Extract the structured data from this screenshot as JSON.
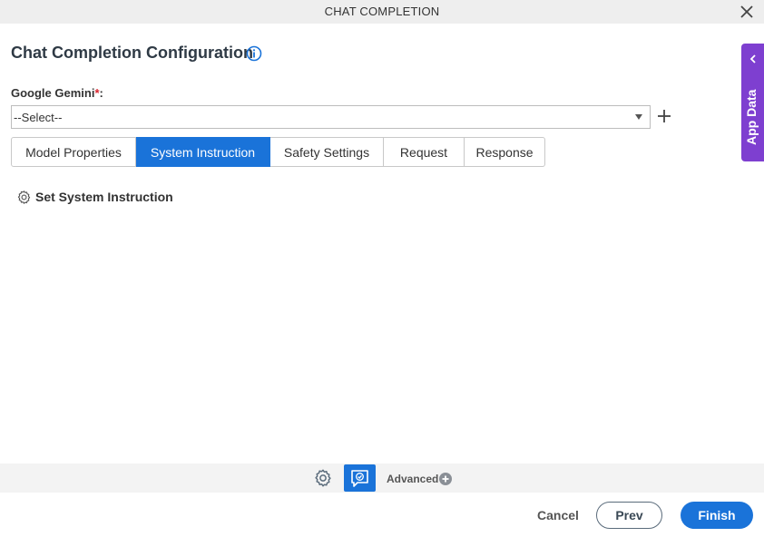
{
  "dialog": {
    "title": "CHAT COMPLETION",
    "close_icon": "close-icon"
  },
  "config": {
    "heading": "Chat Completion Configuration",
    "info_icon": "info-icon"
  },
  "field": {
    "label": "Google Gemini",
    "required_mark": "*",
    "colon": ":",
    "selected": "--Select--",
    "add_icon": "plus-icon"
  },
  "tabs": [
    {
      "label": "Model Properties",
      "active": false
    },
    {
      "label": "System Instruction",
      "active": true
    },
    {
      "label": "Safety Settings",
      "active": false
    },
    {
      "label": "Request",
      "active": false
    },
    {
      "label": "Response",
      "active": false
    }
  ],
  "system_instruction": {
    "link_label": "Set System Instruction",
    "icon": "gear-icon"
  },
  "side_panel": {
    "label": "App Data",
    "icon": "chevron-left-icon"
  },
  "advanced": {
    "label": "Advanced",
    "gear_icon": "gear-icon",
    "chat_icon": "chat-check-icon",
    "plus_icon": "plus-circle-icon"
  },
  "footer": {
    "cancel": "Cancel",
    "prev": "Prev",
    "finish": "Finish"
  },
  "colors": {
    "accent": "#1a73d9",
    "side_panel": "#7e3fd0",
    "required": "#d9232d"
  }
}
